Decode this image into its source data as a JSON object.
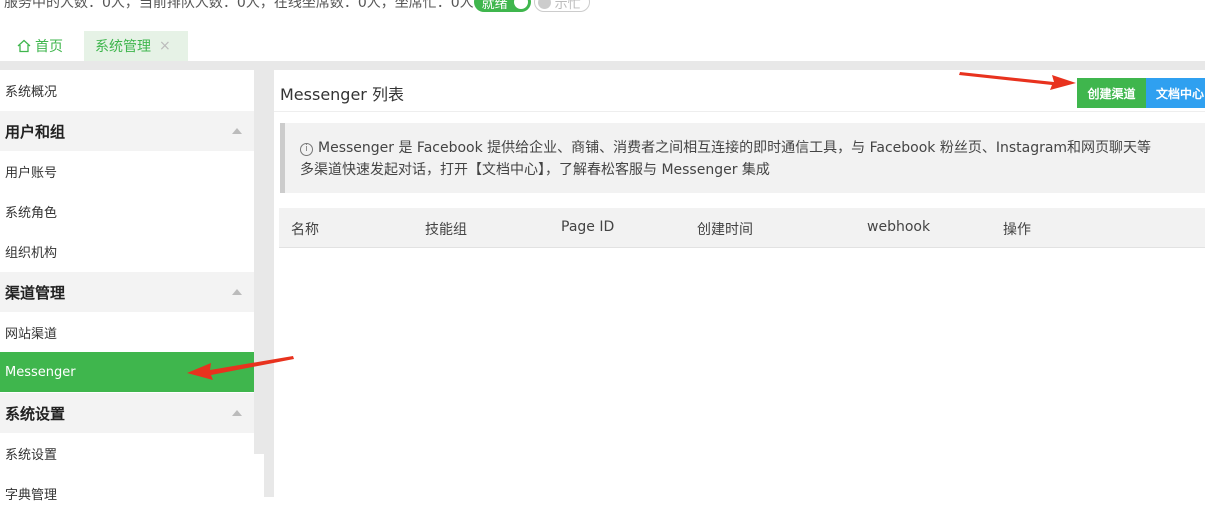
{
  "status": {
    "text": "服务中的人数：0人，当前排队人数：0人，在线坐席数：0人，坐席忙：0人",
    "toggle_on_label": "就绪",
    "toggle_off_label": "示忙"
  },
  "tabs": [
    {
      "label": "首页",
      "icon": "home-icon"
    },
    {
      "label": "系统管理",
      "close": "×"
    }
  ],
  "sidebar": {
    "items": [
      {
        "type": "item",
        "label": "系统概况"
      },
      {
        "type": "group",
        "label": "用户和组"
      },
      {
        "type": "item",
        "label": "用户账号"
      },
      {
        "type": "item",
        "label": "系统角色"
      },
      {
        "type": "item",
        "label": "组织机构"
      },
      {
        "type": "group",
        "label": "渠道管理"
      },
      {
        "type": "item",
        "label": "网站渠道"
      },
      {
        "type": "item",
        "label": "Messenger",
        "active": true
      },
      {
        "type": "group",
        "label": "系统设置"
      },
      {
        "type": "item",
        "label": "系统设置"
      },
      {
        "type": "item",
        "label": "字典管理"
      }
    ]
  },
  "main": {
    "title": "Messenger 列表",
    "create_button": "创建渠道",
    "doc_button": "文档中心",
    "notice_line1": "Messenger 是 Facebook 提供给企业、商铺、消费者之间相互连接的即时通信工具，与 Facebook 粉丝页、Instagram和网页聊天等",
    "notice_line2": "多渠道快速发起对话，打开【文档中心】，了解春松客服与 Messenger 集成",
    "table_columns": [
      "名称",
      "技能组",
      "Page ID",
      "创建时间",
      "webhook",
      "操作"
    ]
  },
  "colors": {
    "accent_green": "#3fb64d",
    "doc_blue": "#2fa0f0",
    "arrow_red": "#e8321e"
  }
}
